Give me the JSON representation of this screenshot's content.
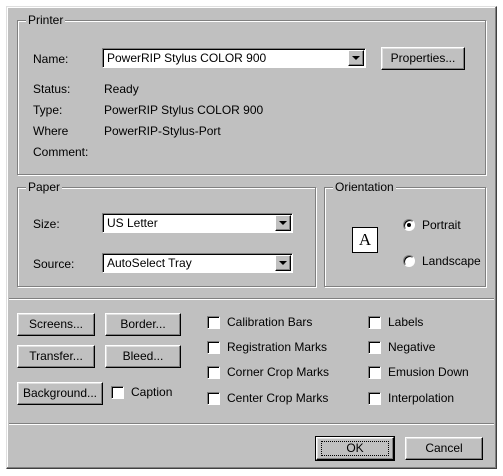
{
  "printer": {
    "group_label": "Printer",
    "name_label": "Name:",
    "name_value": "PowerRIP Stylus COLOR 900",
    "properties_label": "Properties...",
    "status_label": "Status:",
    "status_value": "Ready",
    "type_label": "Type:",
    "type_value": "PowerRIP Stylus COLOR 900",
    "where_label": "Where",
    "where_value": "PowerRIP-Stylus-Port",
    "comment_label": "Comment:",
    "comment_value": ""
  },
  "paper": {
    "group_label": "Paper",
    "size_label": "Size:",
    "size_value": "US Letter",
    "source_label": "Source:",
    "source_value": "AutoSelect Tray"
  },
  "orientation": {
    "group_label": "Orientation",
    "icon_letter": "A",
    "portrait_label": "Portrait",
    "landscape_label": "Landscape",
    "selected": "portrait"
  },
  "options": {
    "screens_label": "Screens...",
    "border_label": "Border...",
    "transfer_label": "Transfer...",
    "bleed_label": "Bleed...",
    "background_label": "Background...",
    "caption_label": "Caption",
    "calibration_bars_label": "Calibration Bars",
    "registration_marks_label": "Registration Marks",
    "corner_crop_marks_label": "Corner Crop Marks",
    "center_crop_marks_label": "Center Crop Marks",
    "labels_label": "Labels",
    "negative_label": "Negative",
    "emulsion_down_label": "Emusion Down",
    "interpolation_label": "Interpolation"
  },
  "footer": {
    "ok_label": "OK",
    "cancel_label": "Cancel"
  }
}
